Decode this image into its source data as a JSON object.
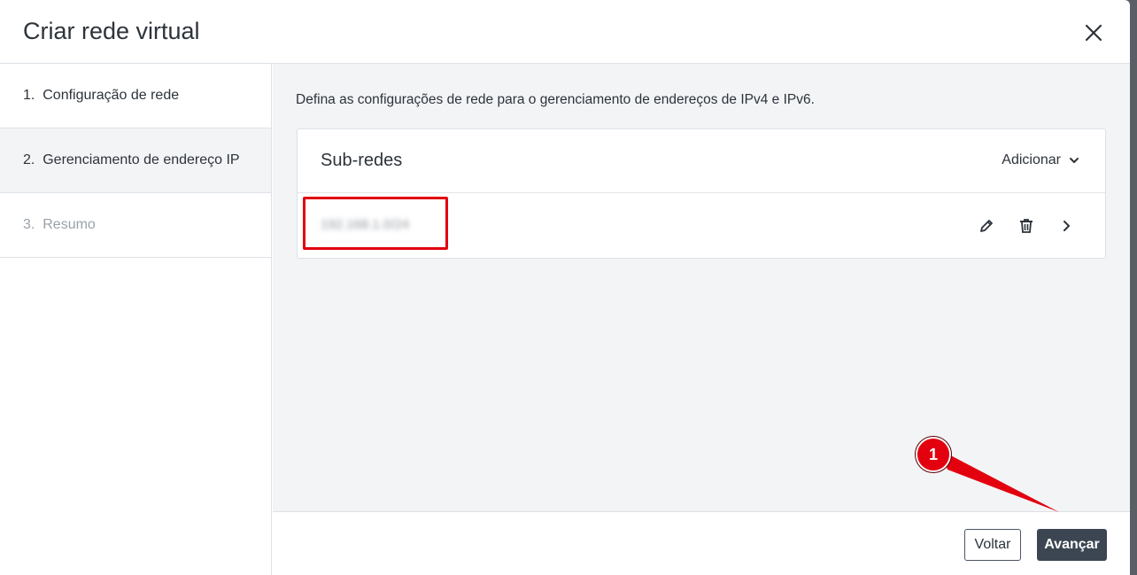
{
  "dialog": {
    "title": "Criar rede virtual",
    "close_icon": "close-icon"
  },
  "steps": [
    {
      "label": "1.  Configuração de rede",
      "state": "done"
    },
    {
      "label": "2.  Gerenciamento de endereço IP",
      "state": "active"
    },
    {
      "label": "3.  Resumo",
      "state": "disabled"
    }
  ],
  "content": {
    "description": "Defina as configurações de rede para o gerenciamento de endereços de IPv4 e IPv6.",
    "subnets": {
      "title": "Sub-redes",
      "add_label": "Adicionar",
      "add_icon": "chevron-down-icon",
      "rows": [
        {
          "value": "192.168.1.0/24",
          "blurred": true
        }
      ],
      "row_icons": [
        "pencil-icon",
        "trash-icon",
        "chevron-right-icon"
      ]
    }
  },
  "footer": {
    "back_label": "Voltar",
    "next_label": "Avançar"
  },
  "annotation": {
    "badge_number": "1",
    "color": "#e3000f"
  }
}
